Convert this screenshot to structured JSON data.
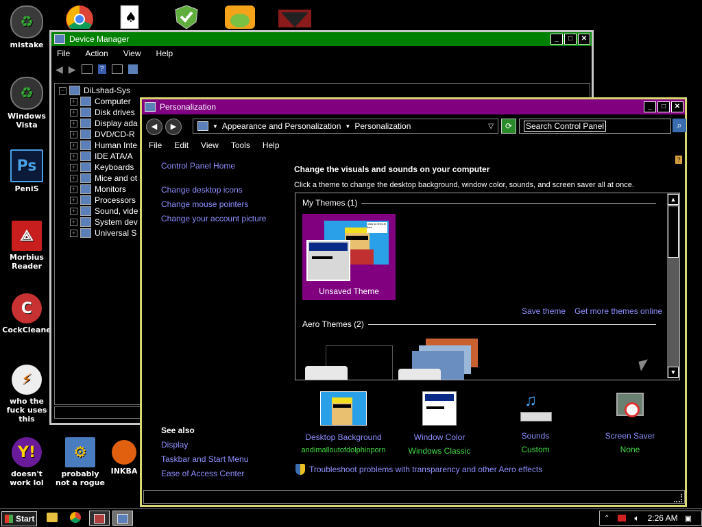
{
  "desktop": {
    "icons": [
      {
        "label": "mistake"
      },
      {
        "label": "Windows Vista"
      },
      {
        "label": "PeniS"
      },
      {
        "label": "Morbius Reader"
      },
      {
        "label": "CockCleane"
      },
      {
        "label": "who the fuck uses this"
      },
      {
        "label": "doesn't work lol"
      },
      {
        "label": "probably not a rogue"
      },
      {
        "label": "INKBA"
      }
    ]
  },
  "device_manager": {
    "title": "Device Manager",
    "menu": [
      "File",
      "Action",
      "View",
      "Help"
    ],
    "root": "DiLshad-Sys",
    "items": [
      "Computer",
      "Disk drives",
      "Display ada",
      "DVD/CD-R",
      "Human Inte",
      "IDE ATA/A",
      "Keyboards",
      "Mice and ot",
      "Monitors",
      "Processors",
      "Sound, vide",
      "System dev",
      "Universal S"
    ]
  },
  "personalization": {
    "title": "Personalization",
    "breadcrumb": [
      "Appearance and Personalization",
      "Personalization"
    ],
    "search_placeholder": "Search Control Panel",
    "menu": [
      "File",
      "Edit",
      "View",
      "Tools",
      "Help"
    ],
    "sidebar": {
      "home": "Control Panel Home",
      "links": [
        "Change desktop icons",
        "Change mouse pointers",
        "Change your account picture"
      ],
      "see_also_title": "See also",
      "see_also": [
        "Display",
        "Taskbar and Start Menu",
        "Ease of Access Center"
      ]
    },
    "heading": "Change the visuals and sounds on your computer",
    "subheading": "Click a theme to change the desktop background, window color, sounds, and screen saver all at once.",
    "my_themes_label": "My Themes (1)",
    "unsaved_theme": "Unsaved Theme",
    "save_theme": "Save theme",
    "get_more": "Get more themes online",
    "aero_themes_label": "Aero Themes (2)",
    "comic_text": "i was so tired at 3am",
    "categories": [
      {
        "title": "Desktop Background",
        "value": "andimalloutofdolphinporn"
      },
      {
        "title": "Window Color",
        "value": "Windows Classic"
      },
      {
        "title": "Sounds",
        "value": "Custom"
      },
      {
        "title": "Screen Saver",
        "value": "None"
      }
    ],
    "troubleshoot": "Troubleshoot problems with transparency and other Aero effects"
  },
  "taskbar": {
    "start": "Start",
    "clock": "2:26 AM"
  },
  "colors": {
    "dm_title": "#008000",
    "pers_title": "#800080",
    "link": "#8f8fff",
    "green_text": "#44dd44",
    "theme_bg": "#800080"
  }
}
